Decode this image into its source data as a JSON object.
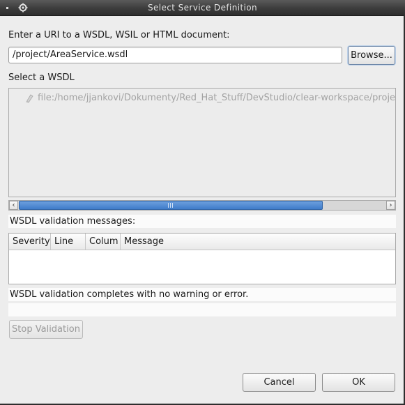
{
  "window": {
    "title": "Select Service Definition",
    "menu_icon": "window-menu-icon",
    "app_icon": "gear-icon"
  },
  "uri": {
    "prompt": "Enter a URI to a WSDL, WSIL or HTML document:",
    "value": "/project/AreaService.wsdl",
    "browse_label": "Browse..."
  },
  "wsdl": {
    "heading": "Select a WSDL",
    "items": [
      {
        "icon": "wsdl-file-icon",
        "label": "file:/home/jjankovi/Dokumenty/Red_Hat_Stuff/DevStudio/clear-workspace/project/"
      }
    ]
  },
  "validation": {
    "heading": "WSDL validation messages:",
    "columns": [
      "Severity",
      "Line",
      "Colum",
      "Message"
    ],
    "rows": [],
    "status": "WSDL validation completes with no warning or error.",
    "stop_label": "Stop Validation"
  },
  "footer": {
    "cancel_label": "Cancel",
    "ok_label": "OK"
  },
  "colors": {
    "titlebar": "#3c3c3c",
    "dialog_bg": "#ededed",
    "scroll_thumb": "#4a86d1",
    "disabled_text": "#a3a3a3"
  }
}
